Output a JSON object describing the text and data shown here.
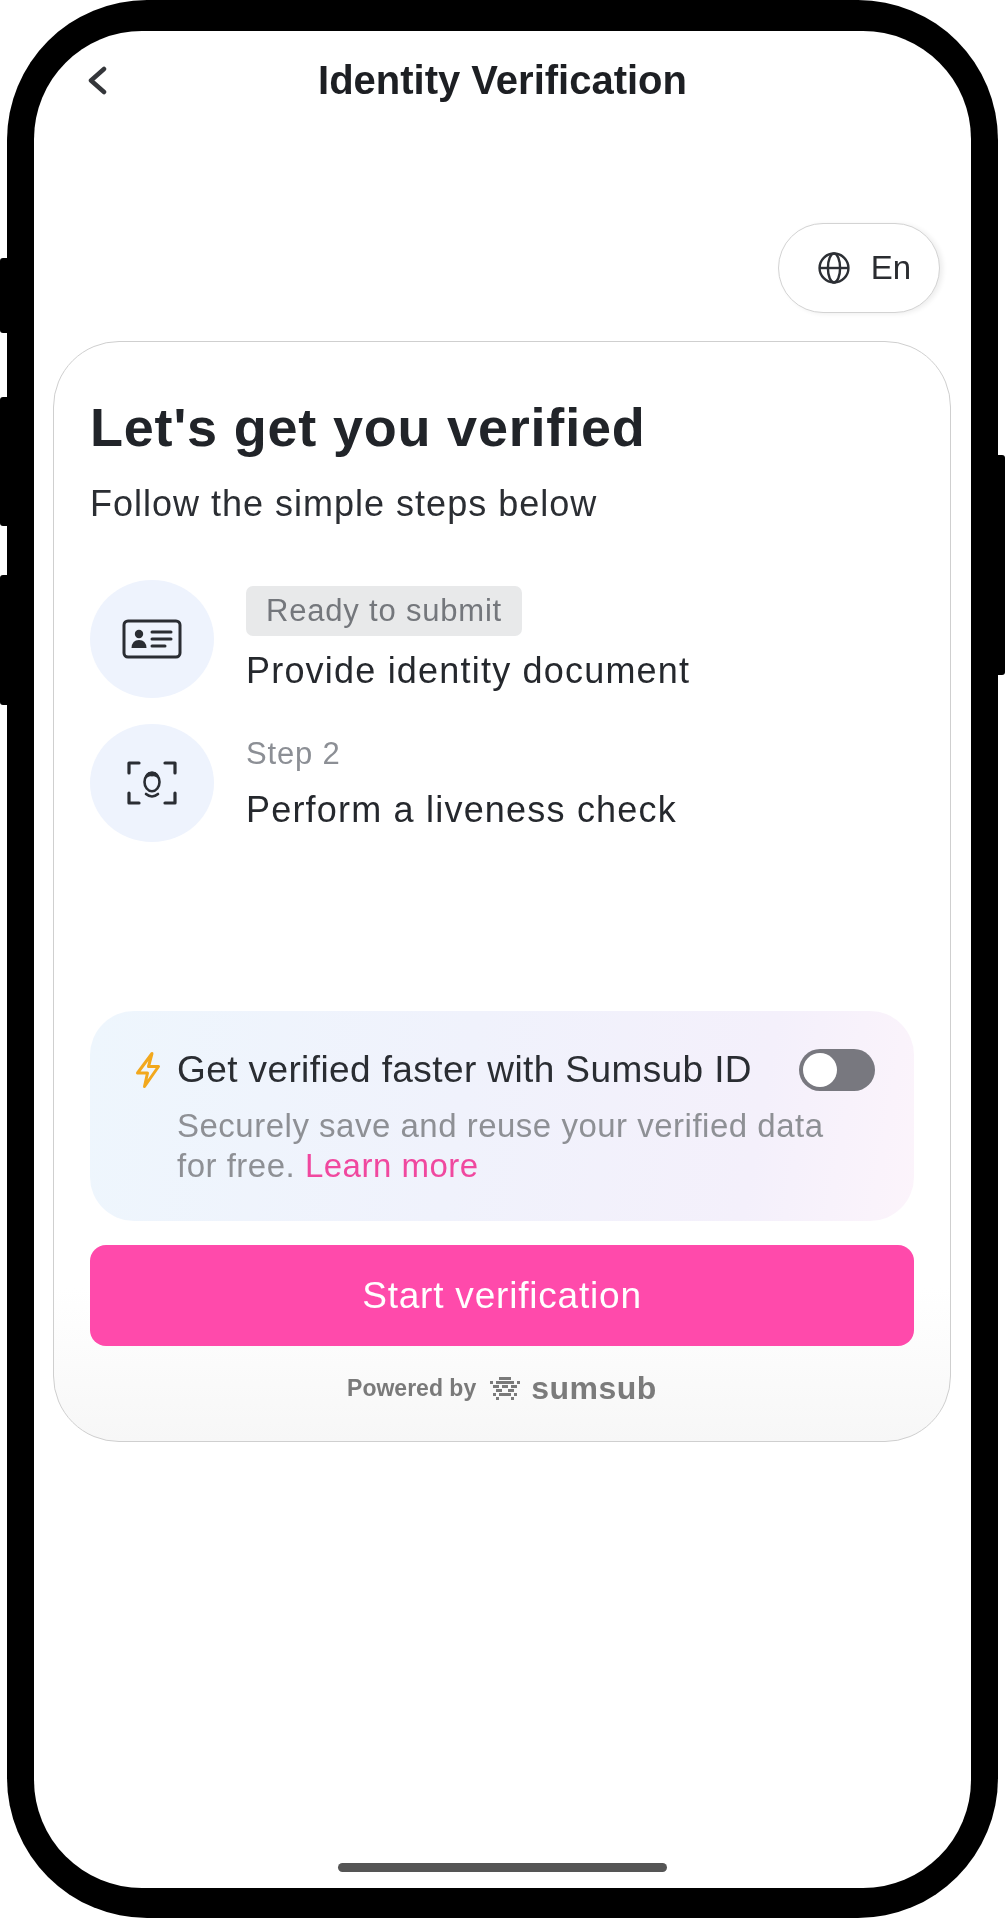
{
  "header": {
    "title": "Identity Verification"
  },
  "language_button": {
    "label": "En"
  },
  "card": {
    "heading": "Let's get you verified",
    "subtitle": "Follow the simple steps below",
    "steps": [
      {
        "kind": "document",
        "status": "Ready to submit",
        "ready": true,
        "title": "Provide identity document"
      },
      {
        "kind": "liveness",
        "status": "Step 2",
        "ready": false,
        "title": "Perform a liveness check"
      }
    ],
    "sumsub_id": {
      "title": "Get verified faster with Sumsub ID",
      "on": false,
      "description": "Securely save and reuse your verified data for free.",
      "link": "Learn more"
    },
    "start_button": {
      "label": "Start verification"
    },
    "powered_by": {
      "label": "Powered by",
      "brand": "sumsub"
    }
  }
}
